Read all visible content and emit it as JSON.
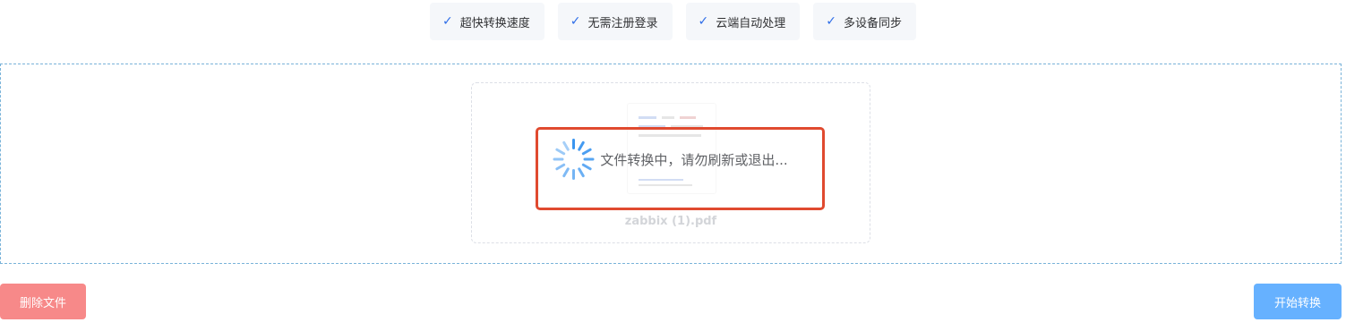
{
  "features": [
    {
      "check_icon": "✓",
      "label": "超快转换速度"
    },
    {
      "check_icon": "✓",
      "label": "无需注册登录"
    },
    {
      "check_icon": "✓",
      "label": "云端自动处理"
    },
    {
      "check_icon": "✓",
      "label": "多设备同步"
    }
  ],
  "file": {
    "name": "zabbix (1).pdf"
  },
  "loading": {
    "text": "文件转换中，请勿刷新或退出..."
  },
  "buttons": {
    "delete_label": "删除文件",
    "start_label": "开始转换"
  },
  "colors": {
    "check": "#2f6ee8",
    "spinner": "#3a95f0",
    "highlight": "#e04a2f",
    "delete_button": "#f78989",
    "start_button": "#66b1ff"
  }
}
